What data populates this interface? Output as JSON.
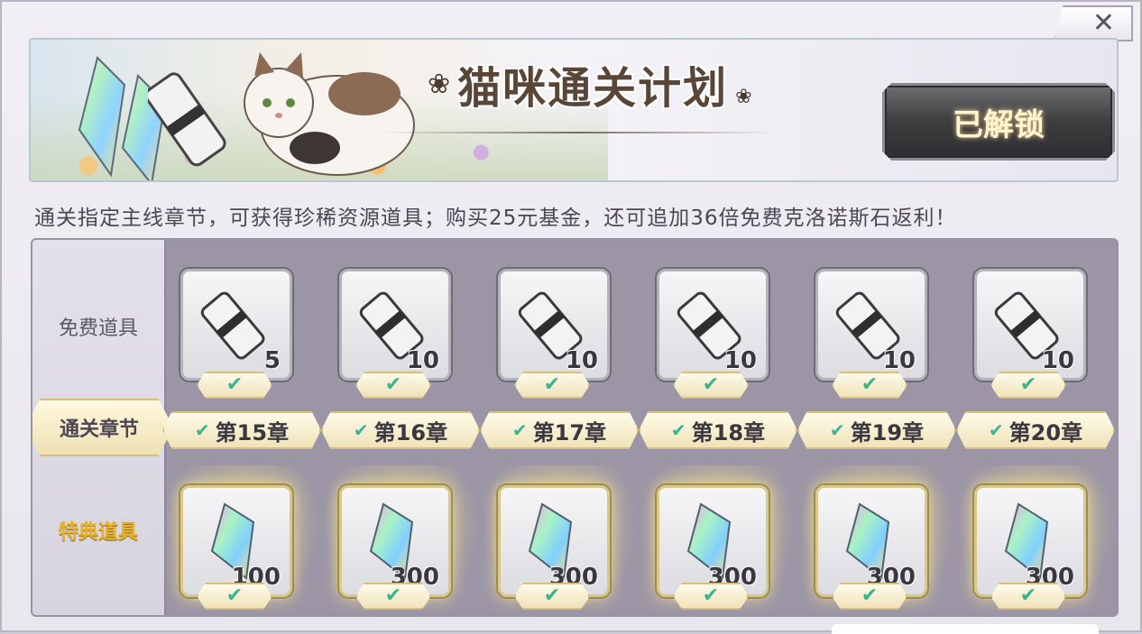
{
  "header": {
    "close_label": "✕"
  },
  "banner": {
    "title": "猫咪通关计划",
    "unlock_label": "已解锁"
  },
  "description": "通关指定主线章节，可获得珍稀资源道具；购买25元基金，还可追加36倍免费克洛诺斯石返利！",
  "rows": {
    "free_label": "免费道具",
    "chapter_label": "通关章节",
    "special_label": "特典道具"
  },
  "columns": [
    {
      "chapter": "第15章",
      "free_item_icon": "scroll-icon",
      "free_qty": "5",
      "special_item_icon": "crystal-icon",
      "special_qty": "100",
      "free_claimed": true,
      "chapter_cleared": true,
      "special_claimed": true
    },
    {
      "chapter": "第16章",
      "free_item_icon": "scroll-icon",
      "free_qty": "10",
      "special_item_icon": "crystal-icon",
      "special_qty": "300",
      "free_claimed": true,
      "chapter_cleared": true,
      "special_claimed": true
    },
    {
      "chapter": "第17章",
      "free_item_icon": "scroll-icon",
      "free_qty": "10",
      "special_item_icon": "crystal-icon",
      "special_qty": "300",
      "free_claimed": true,
      "chapter_cleared": true,
      "special_claimed": true
    },
    {
      "chapter": "第18章",
      "free_item_icon": "scroll-icon",
      "free_qty": "10",
      "special_item_icon": "crystal-icon",
      "special_qty": "300",
      "free_claimed": true,
      "chapter_cleared": true,
      "special_claimed": true
    },
    {
      "chapter": "第19章",
      "free_item_icon": "scroll-icon",
      "free_qty": "10",
      "special_item_icon": "crystal-icon",
      "special_qty": "300",
      "free_claimed": true,
      "chapter_cleared": true,
      "special_claimed": true
    },
    {
      "chapter": "第20章",
      "free_item_icon": "scroll-icon",
      "free_qty": "10",
      "special_item_icon": "crystal-icon",
      "special_qty": "300",
      "free_claimed": true,
      "chapter_cleared": true,
      "special_claimed": true
    }
  ],
  "check_glyph": "✔",
  "colors": {
    "check": "#3cb28f",
    "special_label": "#e7b32f",
    "title": "#5a4636"
  }
}
